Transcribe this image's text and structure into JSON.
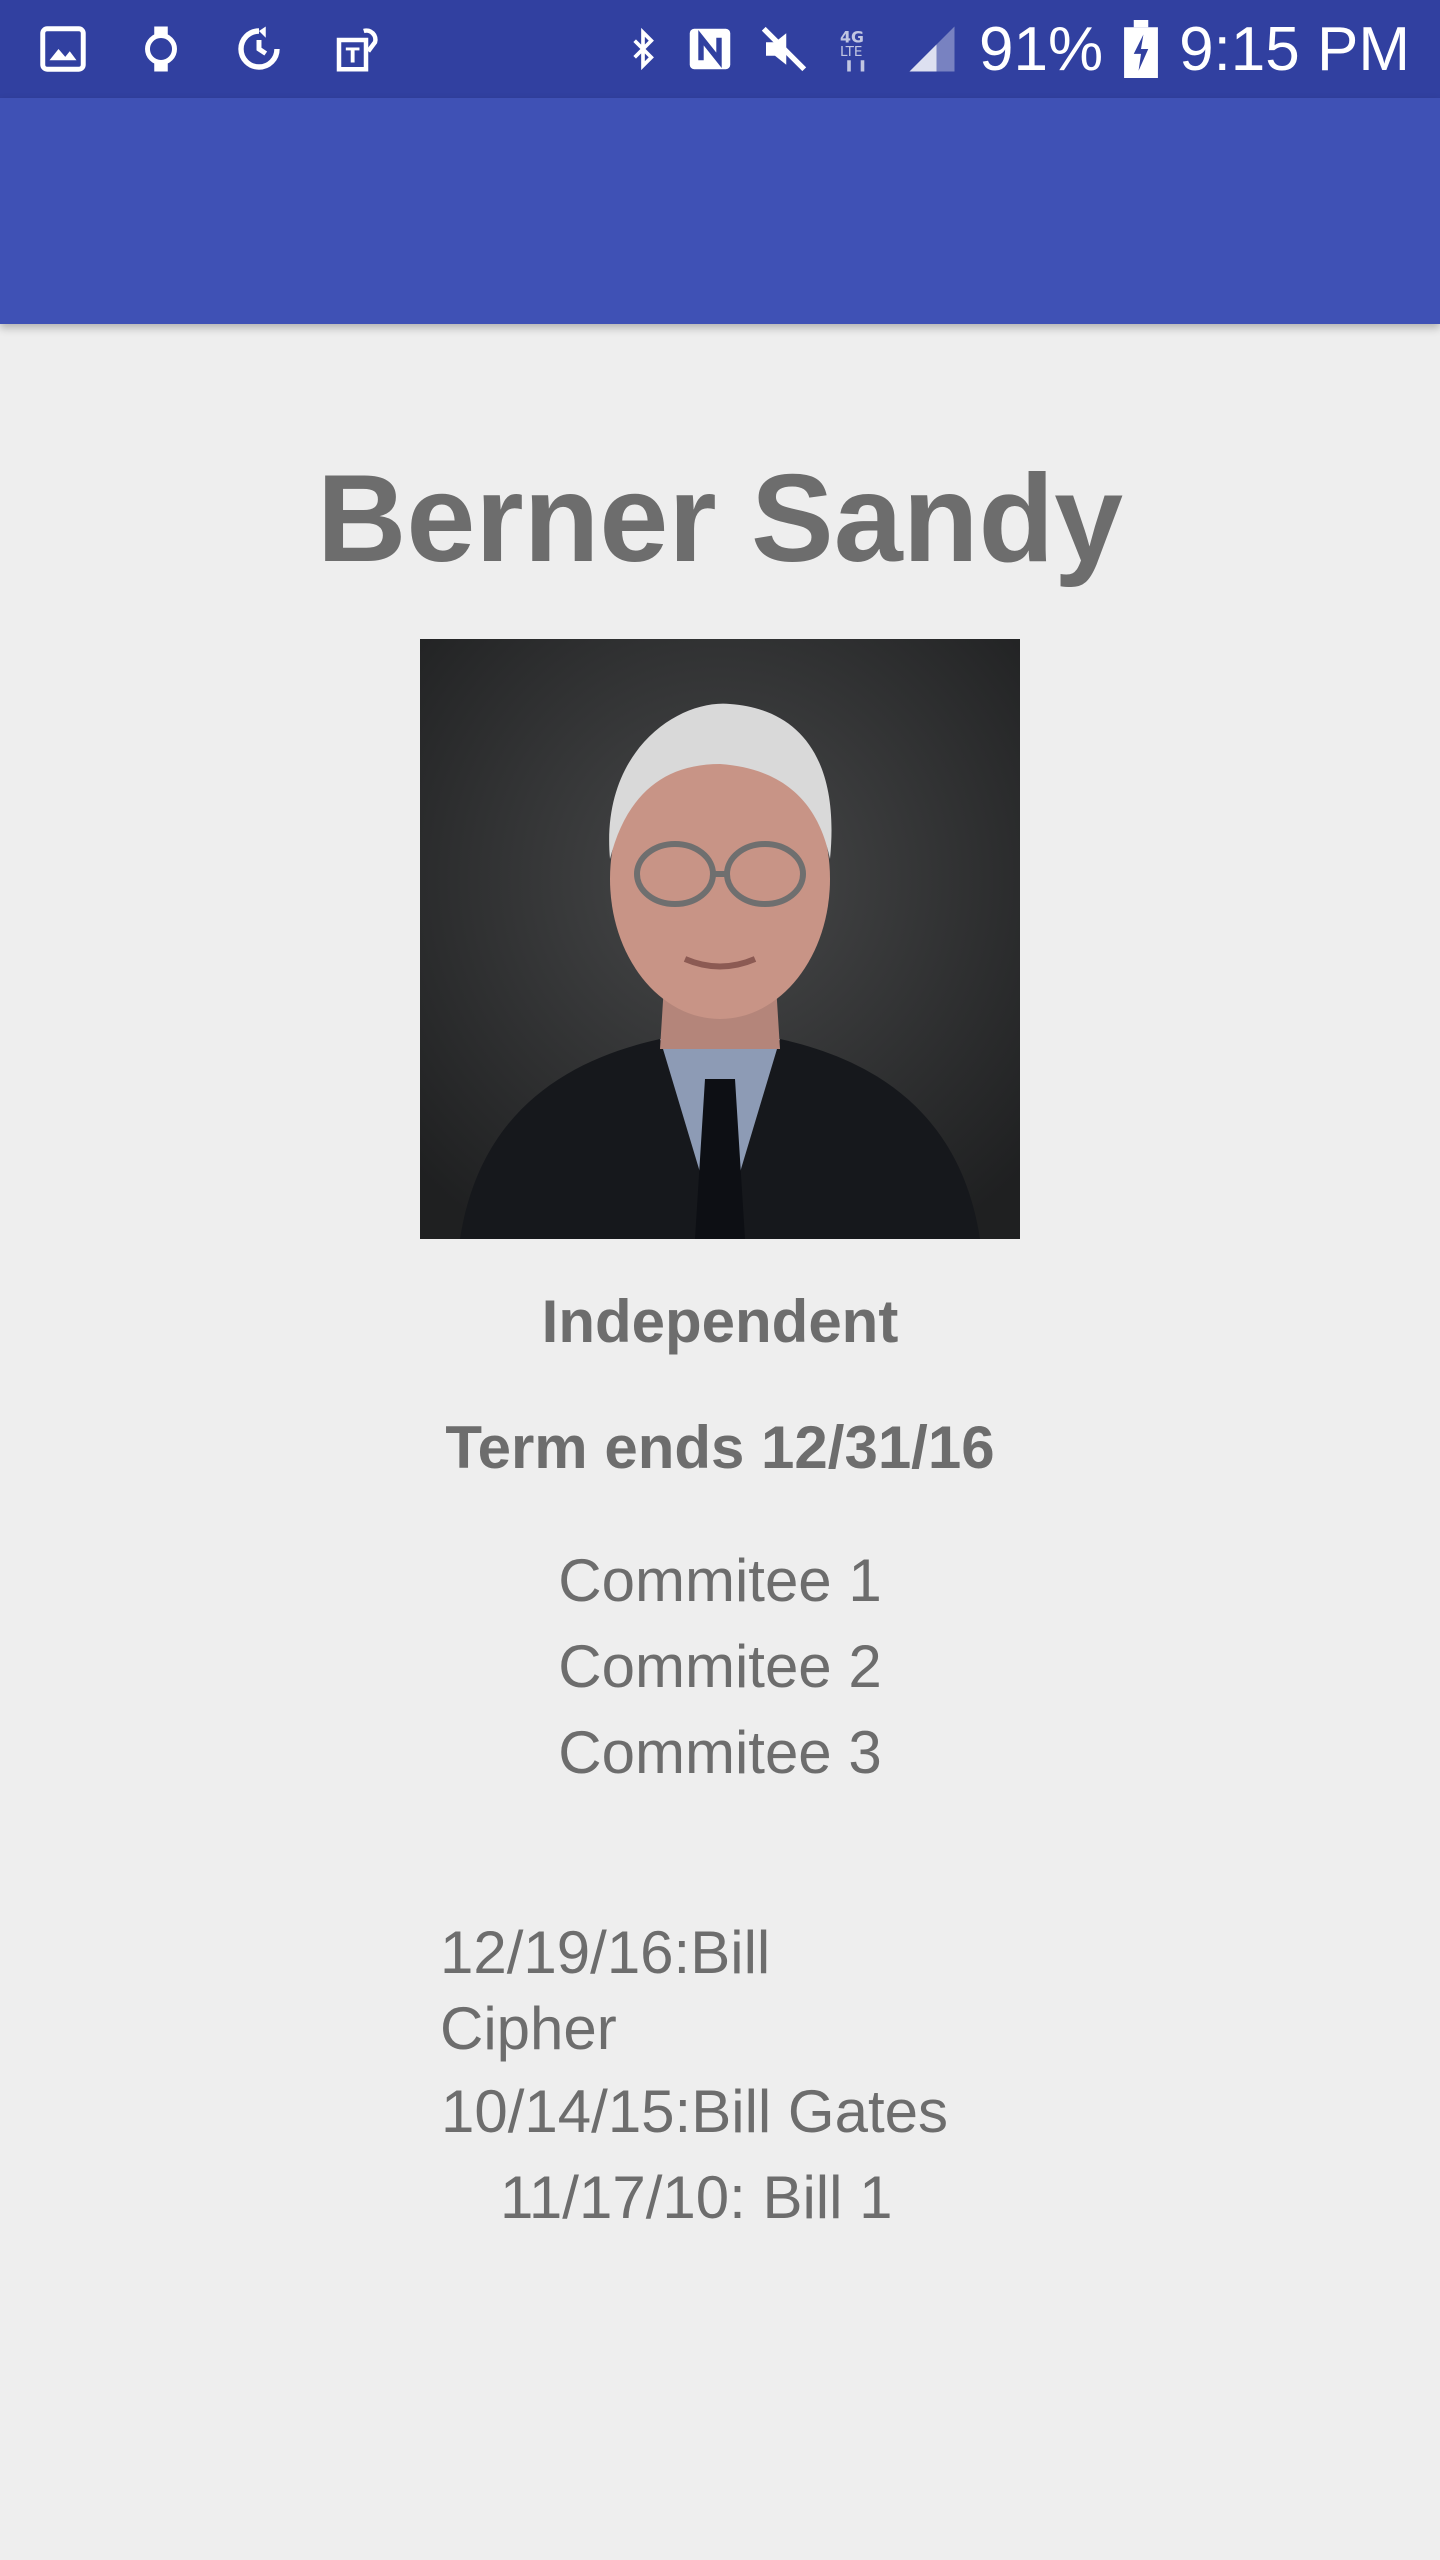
{
  "status_bar": {
    "icons_left": [
      "image-icon",
      "watch-icon",
      "sync-icon",
      "t-mobile-icon"
    ],
    "icons_right": [
      "bluetooth-icon",
      "nfc-icon",
      "mute-icon",
      "lte-icon",
      "signal-icon"
    ],
    "battery": "91%",
    "time": "9:15 PM",
    "background": "#3140a0"
  },
  "app_bar": {
    "background": "#3f51b5"
  },
  "profile": {
    "name": "Berner Sandy",
    "party": "Independent",
    "term": "Term ends 12/31/16",
    "committees": [
      "Commitee 1",
      "Commitee 2",
      "Commitee 3"
    ],
    "bills": [
      "12/19/16:Bill Cipher",
      "10/14/15:Bill Gates",
      "11/17/10: Bill 1"
    ]
  },
  "colors": {
    "text": "#6d6d6d",
    "background": "#eeeeee"
  }
}
